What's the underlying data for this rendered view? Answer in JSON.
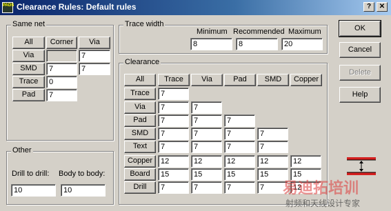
{
  "window": {
    "title": "Clearance Rules: Default rules",
    "app_icon_text": "PADS",
    "help_btn": "?",
    "close_btn": "✕"
  },
  "same_net": {
    "legend": "Same net",
    "headers": [
      "All",
      "Corner",
      "Via"
    ],
    "rows": [
      {
        "label": "Via",
        "corner": "",
        "via": "7"
      },
      {
        "label": "SMD",
        "corner": "7",
        "via": "7"
      },
      {
        "label": "Trace",
        "corner": "0"
      },
      {
        "label": "Pad",
        "corner": "7"
      }
    ]
  },
  "trace_width": {
    "legend": "Trace width",
    "minimum_label": "Minimum",
    "recommended_label": "Recommended",
    "maximum_label": "Maximum",
    "minimum": "8",
    "recommended": "8",
    "maximum": "20"
  },
  "clearance": {
    "legend": "Clearance",
    "all_label": "All",
    "columns": [
      "Trace",
      "Via",
      "Pad",
      "SMD",
      "Copper"
    ],
    "rows": [
      {
        "label": "Trace",
        "values": [
          "7"
        ]
      },
      {
        "label": "Via",
        "values": [
          "7",
          "7"
        ]
      },
      {
        "label": "Pad",
        "values": [
          "7",
          "7",
          "7"
        ]
      },
      {
        "label": "SMD",
        "values": [
          "7",
          "7",
          "7",
          "7"
        ]
      },
      {
        "label": "Text",
        "values": [
          "7",
          "7",
          "7",
          "7"
        ]
      },
      {
        "label": "Copper",
        "values": [
          "12",
          "12",
          "12",
          "12",
          "12"
        ]
      },
      {
        "label": "Board",
        "values": [
          "15",
          "15",
          "15",
          "15",
          "15"
        ]
      },
      {
        "label": "Drill",
        "values": [
          "7",
          "7",
          "7",
          "7",
          "12"
        ]
      }
    ]
  },
  "other": {
    "legend": "Other",
    "drill_label": "Drill to drill:",
    "body_label": "Body to body:",
    "drill_value": "10",
    "body_value": "10"
  },
  "buttons": {
    "ok": "OK",
    "cancel": "Cancel",
    "delete": "Delete",
    "help": "Help"
  },
  "watermark": {
    "big": "易迪拓培训",
    "small": "射频和天线设计专家"
  },
  "colors": {
    "accent_red": "#d42020"
  }
}
